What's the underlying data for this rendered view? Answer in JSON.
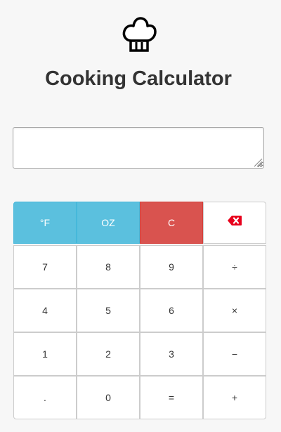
{
  "header": {
    "logo_icon": "chef-hat-icon",
    "title": "Cooking Calculator"
  },
  "display": {
    "value": ""
  },
  "colors": {
    "info": "#5bc0de",
    "danger": "#d9534f",
    "backspace_icon": "#e8001c"
  },
  "keypad": {
    "fahrenheit": "°F",
    "ounces": "OZ",
    "clear": "C",
    "backspace_icon": "backspace-icon",
    "seven": "7",
    "eight": "8",
    "nine": "9",
    "divide": "÷",
    "four": "4",
    "five": "5",
    "six": "6",
    "multiply": "×",
    "one": "1",
    "two": "2",
    "three": "3",
    "subtract": "−",
    "decimal": ".",
    "zero": "0",
    "equals": "=",
    "add": "+"
  }
}
